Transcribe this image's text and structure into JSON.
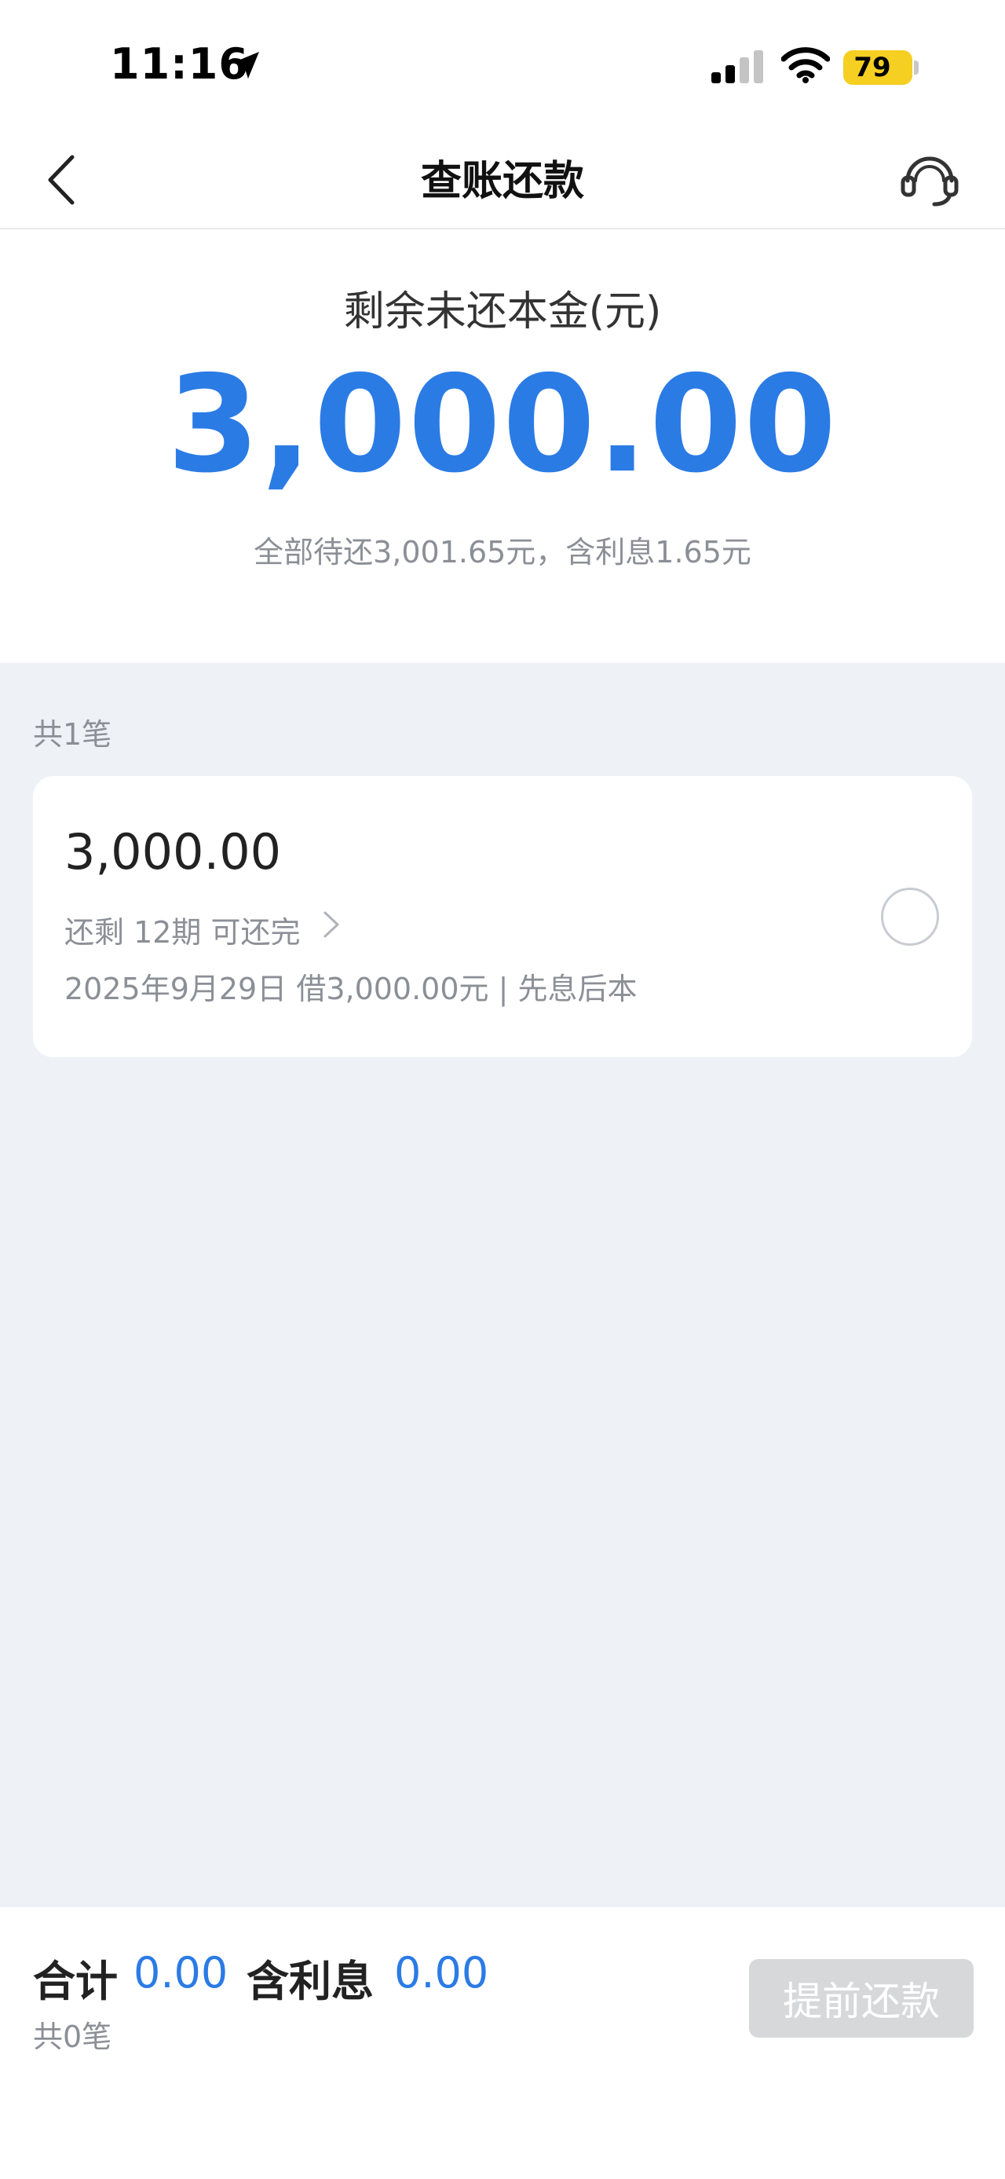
{
  "status_bar": {
    "time": "11:16",
    "battery": "79",
    "icons": [
      "location-arrow-icon",
      "cellular-signal-icon",
      "wifi-icon",
      "battery-icon"
    ]
  },
  "nav": {
    "title": "查账还款",
    "back_icon": "chevron-left-icon",
    "service_icon": "customer-service-headset-icon"
  },
  "summary": {
    "label": "剩余未还本金(元)",
    "amount": "3,000.00",
    "note": "全部待还3,001.65元，含利息1.65元"
  },
  "list": {
    "count_label": "共1笔",
    "items": [
      {
        "amount": "3,000.00",
        "term": "还剩 12期 可还完",
        "detail": "2025年9月29日 借3,000.00元 | 先息后本"
      }
    ]
  },
  "footer": {
    "total_label": "合计",
    "total_value": "0.00",
    "interest_label": "含利息",
    "interest_value": "0.00",
    "count": "共0笔",
    "button_label": "提前还款"
  },
  "colors": {
    "accent": "#2b7be5",
    "page_bg": "#eef2f7",
    "muted_text": "#8b8f96",
    "battery": "#f5cf22",
    "disabled_button": "#d7d8da"
  }
}
